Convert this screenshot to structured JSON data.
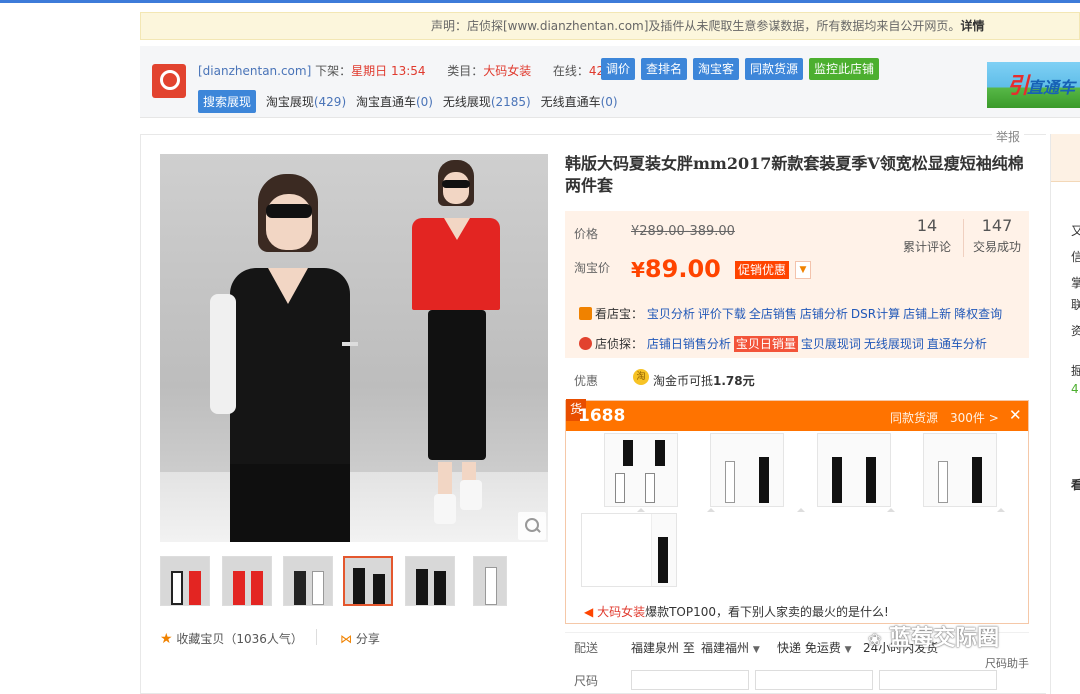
{
  "notice": {
    "text": "声明：店侦探[www.dianzhentan.com]及插件从未爬取生意参谋数据，所有数据均来自公开网页。",
    "more": "详情"
  },
  "plugin": {
    "site": "[dianzhentan.com]",
    "offshelf_label": "下架：",
    "offshelf_value": "星期日 13:54",
    "category_label": "类目：",
    "category_value": "大码女装",
    "online_label": "在线：",
    "online_value": "423人",
    "buttons": [
      "调价",
      "查排名",
      "淘宝客",
      "同款货源",
      "监控此店铺"
    ],
    "active_tab": "搜索展现",
    "tabs": [
      {
        "label": "淘宝展现",
        "count": "(429)"
      },
      {
        "label": "淘宝直通车",
        "count": "(0)"
      },
      {
        "label": "无线展现",
        "count": "(2185)"
      },
      {
        "label": "无线直通车",
        "count": "(0)"
      }
    ],
    "ad_text": "直通车",
    "ad_text2": "引"
  },
  "report": "举报",
  "product": {
    "title": "韩版大码夏装女胖mm2017新款套装夏季V领宽松显瘦短袖纯棉两件套",
    "price_label": "价格",
    "orig_price": "¥289.00-389.00",
    "tb_price_label": "淘宝价",
    "currency": "¥",
    "cur_price": "89.00",
    "promo": "促销优惠",
    "reviews": {
      "count": "14",
      "label": "累计评论"
    },
    "sales": {
      "count": "147",
      "label": "交易成功"
    },
    "kandian_label": "看店宝：",
    "kandian_links": [
      "宝贝分析",
      "评价下载",
      "全店销售",
      "店铺分析",
      "DSR计算",
      "店铺上新",
      "降权查询"
    ],
    "dianzhentan_label": "店侦探：",
    "dianzhentan_links": [
      "店铺日销售分析",
      "宝贝日销量",
      "宝贝展现词",
      "无线展现词",
      "直通车分析"
    ],
    "youhui_label": "优惠",
    "coin_icon": "淘",
    "youhui_text": "淘金币可抵",
    "youhui_value": "1.78元",
    "favorite": "收藏宝贝（1036人气）",
    "share": "分享"
  },
  "panel1688": {
    "huo": "货",
    "brand": "1688",
    "same": "同款货源　300件 >",
    "close": "✕",
    "hot_prefix": "大码女装",
    "hot_text": "爆款TOP100，看下别人家卖的最火的是什么!"
  },
  "shipping": {
    "label": "配送",
    "from": "福建泉州 至",
    "to": "福建福州",
    "express": "快递 免运费",
    "time": "24小时内发货"
  },
  "sizes_label": "尺码",
  "right_col": [
    "又",
    "信",
    "掌",
    "联",
    "资",
    "掘",
    "4.",
    "看"
  ],
  "watermark": {
    "icon": "❀",
    "text": "蓝莓交际圈",
    "sub": "尺码助手"
  }
}
